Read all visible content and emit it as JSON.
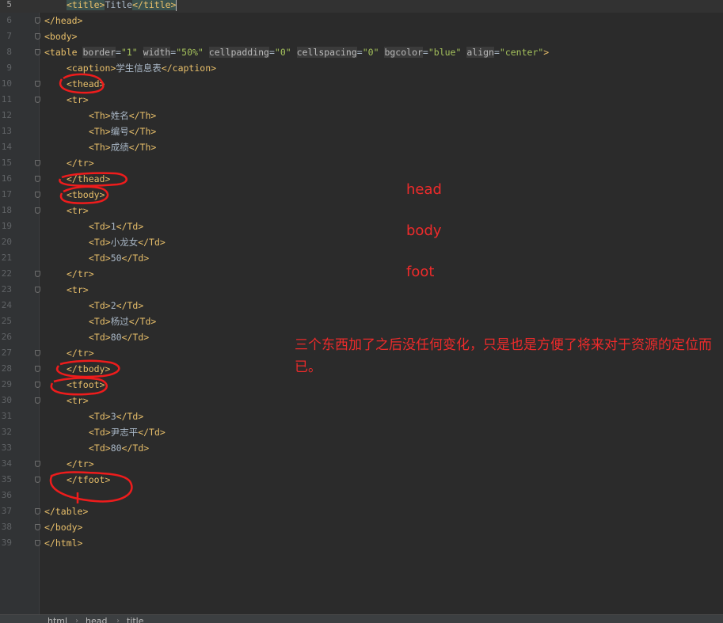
{
  "lines": [
    {
      "n": "5",
      "i": 4,
      "t": [
        [
          "tag",
          "<title>"
        ],
        [
          "txt",
          "Title"
        ],
        [
          "tag",
          "</title>"
        ]
      ],
      "cursor": true,
      "current": true
    },
    {
      "n": "6",
      "i": 0,
      "t": [
        [
          "tag",
          "</head>"
        ]
      ]
    },
    {
      "n": "7",
      "i": 0,
      "t": [
        [
          "tag",
          "<body>"
        ]
      ]
    },
    {
      "n": "8",
      "i": 0,
      "t": [
        [
          "tag",
          "<table "
        ],
        [
          "attr",
          "border"
        ],
        [
          "eq",
          "="
        ],
        [
          "val",
          "\"1\""
        ],
        [
          "txt",
          " "
        ],
        [
          "attr",
          "width"
        ],
        [
          "eq",
          "="
        ],
        [
          "val",
          "\"50%\""
        ],
        [
          "txt",
          " "
        ],
        [
          "attr",
          "cellpadding"
        ],
        [
          "eq",
          "="
        ],
        [
          "val",
          "\"0\""
        ],
        [
          "txt",
          " "
        ],
        [
          "attr",
          "cellspacing"
        ],
        [
          "eq",
          "="
        ],
        [
          "val",
          "\"0\""
        ],
        [
          "txt",
          " "
        ],
        [
          "attr",
          "bgcolor"
        ],
        [
          "eq",
          "="
        ],
        [
          "val",
          "\"blue\""
        ],
        [
          "txt",
          " "
        ],
        [
          "attr",
          "align"
        ],
        [
          "eq",
          "="
        ],
        [
          "val",
          "\"center\""
        ],
        [
          "tag",
          ">"
        ]
      ]
    },
    {
      "n": "9",
      "i": 4,
      "t": [
        [
          "tag",
          "<caption>"
        ],
        [
          "txt",
          "学生信息表"
        ],
        [
          "tag",
          "</caption>"
        ]
      ]
    },
    {
      "n": "10",
      "i": 4,
      "t": [
        [
          "tag",
          "<thead>"
        ]
      ]
    },
    {
      "n": "11",
      "i": 4,
      "t": [
        [
          "tag",
          "<tr>"
        ]
      ]
    },
    {
      "n": "12",
      "i": 8,
      "t": [
        [
          "tag",
          "<Th>"
        ],
        [
          "txt",
          "姓名"
        ],
        [
          "tag",
          "</Th>"
        ]
      ]
    },
    {
      "n": "13",
      "i": 8,
      "t": [
        [
          "tag",
          "<Th>"
        ],
        [
          "txt",
          "编号"
        ],
        [
          "tag",
          "</Th>"
        ]
      ]
    },
    {
      "n": "14",
      "i": 8,
      "t": [
        [
          "tag",
          "<Th>"
        ],
        [
          "txt",
          "成绩"
        ],
        [
          "tag",
          "</Th>"
        ]
      ]
    },
    {
      "n": "15",
      "i": 4,
      "t": [
        [
          "tag",
          "</tr>"
        ]
      ]
    },
    {
      "n": "16",
      "i": 4,
      "t": [
        [
          "tag",
          "</thead>"
        ]
      ]
    },
    {
      "n": "17",
      "i": 4,
      "t": [
        [
          "tag",
          "<tbody>"
        ]
      ]
    },
    {
      "n": "18",
      "i": 4,
      "t": [
        [
          "tag",
          "<tr>"
        ]
      ]
    },
    {
      "n": "19",
      "i": 8,
      "t": [
        [
          "tag",
          "<Td>"
        ],
        [
          "txt",
          "1"
        ],
        [
          "tag",
          "</Td>"
        ]
      ]
    },
    {
      "n": "20",
      "i": 8,
      "t": [
        [
          "tag",
          "<Td>"
        ],
        [
          "txt",
          "小龙女"
        ],
        [
          "tag",
          "</Td>"
        ]
      ]
    },
    {
      "n": "21",
      "i": 8,
      "t": [
        [
          "tag",
          "<Td>"
        ],
        [
          "txt",
          "50"
        ],
        [
          "tag",
          "</Td>"
        ]
      ]
    },
    {
      "n": "22",
      "i": 4,
      "t": [
        [
          "tag",
          "</tr>"
        ]
      ]
    },
    {
      "n": "23",
      "i": 4,
      "t": [
        [
          "tag",
          "<tr>"
        ]
      ]
    },
    {
      "n": "24",
      "i": 8,
      "t": [
        [
          "tag",
          "<Td>"
        ],
        [
          "txt",
          "2"
        ],
        [
          "tag",
          "</Td>"
        ]
      ]
    },
    {
      "n": "25",
      "i": 8,
      "t": [
        [
          "tag",
          "<Td>"
        ],
        [
          "txt",
          "杨过"
        ],
        [
          "tag",
          "</Td>"
        ]
      ]
    },
    {
      "n": "26",
      "i": 8,
      "t": [
        [
          "tag",
          "<Td>"
        ],
        [
          "txt",
          "80"
        ],
        [
          "tag",
          "</Td>"
        ]
      ]
    },
    {
      "n": "27",
      "i": 4,
      "t": [
        [
          "tag",
          "</tr>"
        ]
      ]
    },
    {
      "n": "28",
      "i": 4,
      "t": [
        [
          "tag",
          "</tbody>"
        ]
      ]
    },
    {
      "n": "29",
      "i": 4,
      "t": [
        [
          "tag",
          "<tfoot>"
        ]
      ]
    },
    {
      "n": "30",
      "i": 4,
      "t": [
        [
          "tag",
          "<tr>"
        ]
      ]
    },
    {
      "n": "31",
      "i": 8,
      "t": [
        [
          "tag",
          "<Td>"
        ],
        [
          "txt",
          "3"
        ],
        [
          "tag",
          "</Td>"
        ]
      ]
    },
    {
      "n": "32",
      "i": 8,
      "t": [
        [
          "tag",
          "<Td>"
        ],
        [
          "txt",
          "尹志平"
        ],
        [
          "tag",
          "</Td>"
        ]
      ]
    },
    {
      "n": "33",
      "i": 8,
      "t": [
        [
          "tag",
          "<Td>"
        ],
        [
          "txt",
          "80"
        ],
        [
          "tag",
          "</Td>"
        ]
      ]
    },
    {
      "n": "34",
      "i": 4,
      "t": [
        [
          "tag",
          "</tr>"
        ]
      ]
    },
    {
      "n": "35",
      "i": 4,
      "t": [
        [
          "tag",
          "</tfoot>"
        ]
      ]
    },
    {
      "n": "36",
      "i": 0,
      "t": []
    },
    {
      "n": "37",
      "i": 0,
      "t": [
        [
          "tag",
          "</table>"
        ]
      ]
    },
    {
      "n": "38",
      "i": 0,
      "t": [
        [
          "tag",
          "</body>"
        ]
      ]
    },
    {
      "n": "39",
      "i": 0,
      "t": [
        [
          "tag",
          "</html>"
        ]
      ]
    }
  ],
  "annotations": {
    "head": "head",
    "body": "body",
    "foot": "foot",
    "note": "三个东西加了之后没任何变化，只是也是方便了将来对于资源的定位而已。"
  },
  "breadcrumb": [
    "html",
    "head",
    "title"
  ],
  "colors": {
    "background": "#2b2b2b",
    "tag": "#e8bf6a",
    "attribute_value": "#a5c25c",
    "annotation": "#ee2b2b"
  }
}
